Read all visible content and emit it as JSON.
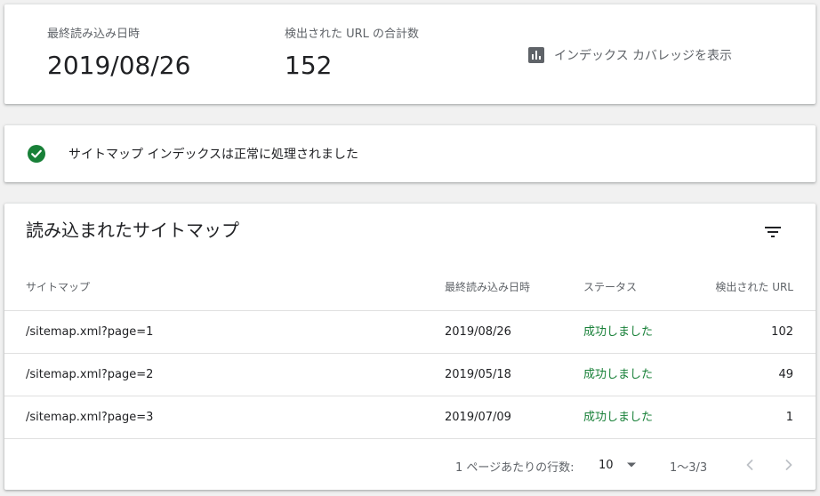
{
  "summary": {
    "last_read_label": "最終読み込み日時",
    "last_read_value": "2019/08/26",
    "url_count_label": "検出された URL の合計数",
    "url_count_value": "152",
    "coverage_link_label": "インデックス カバレッジを表示",
    "coverage_icon": "bar-chart-icon"
  },
  "status": {
    "icon": "check-circle-icon",
    "color": "#188038",
    "message": "サイトマップ インデックスは正常に処理されました"
  },
  "table": {
    "title": "読み込まれたサイトマップ",
    "filter_icon": "filter-icon",
    "columns": {
      "sitemap": "サイトマップ",
      "last_read": "最終読み込み日時",
      "status": "ステータス",
      "urls": "検出された URL"
    },
    "rows": [
      {
        "sitemap": "/sitemap.xml?page=1",
        "last_read": "2019/08/26",
        "status": "成功しました",
        "urls": "102"
      },
      {
        "sitemap": "/sitemap.xml?page=2",
        "last_read": "2019/05/18",
        "status": "成功しました",
        "urls": "49"
      },
      {
        "sitemap": "/sitemap.xml?page=3",
        "last_read": "2019/07/09",
        "status": "成功しました",
        "urls": "1"
      }
    ]
  },
  "pagination": {
    "rows_per_page_label": "1 ページあたりの行数:",
    "rows_per_page_value": "10",
    "range": "1〜3/3"
  }
}
